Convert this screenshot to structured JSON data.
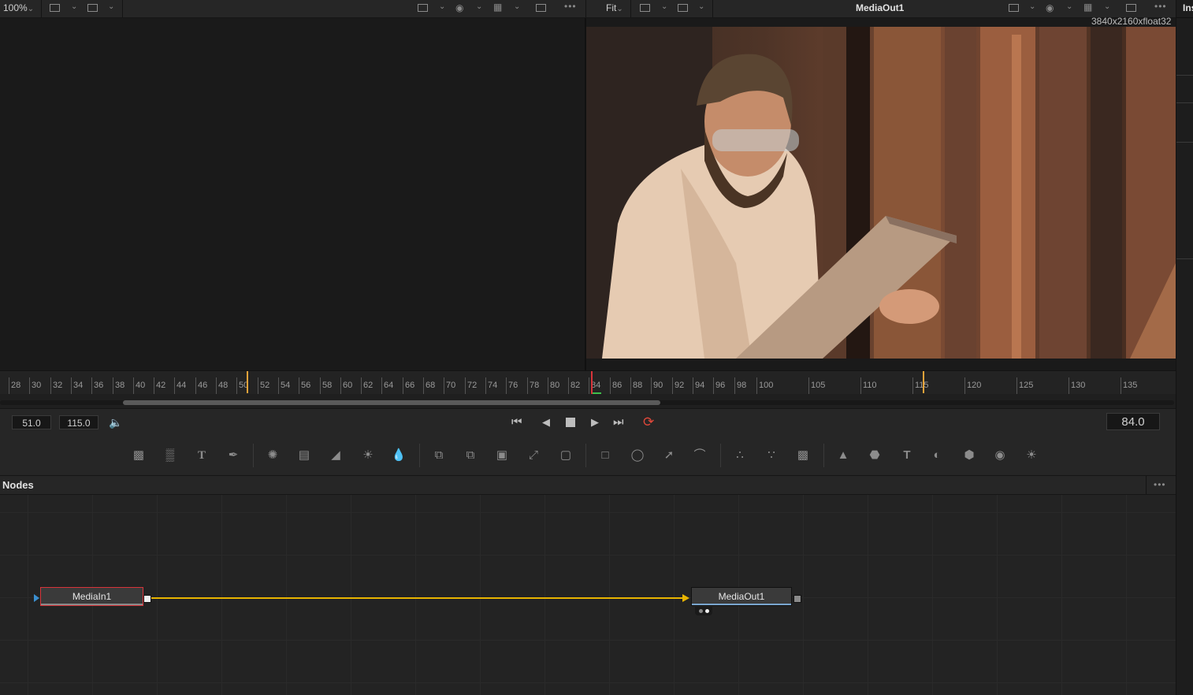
{
  "left_viewer": {
    "zoom": "100%",
    "zoom_chevron": "chevron-down-icon"
  },
  "right_viewer": {
    "zoom": "Fit",
    "title": "MediaOut1",
    "resolution": "3840x2160xfloat32"
  },
  "right_panel": {
    "label": "Ins"
  },
  "ruler": {
    "ticks_left": [
      "28",
      "30",
      "32",
      "34",
      "36",
      "38",
      "40",
      "42",
      "44",
      "46",
      "48",
      "50",
      "52",
      "54",
      "56",
      "58",
      "60",
      "62",
      "64",
      "66",
      "68",
      "70",
      "72",
      "74",
      "76",
      "78",
      "80",
      "82",
      "84",
      "86",
      "88",
      "90",
      "92",
      "94",
      "96",
      "98"
    ],
    "ticks_right": [
      "100",
      "105",
      "110",
      "115",
      "120",
      "125",
      "130",
      "135"
    ],
    "current_frame": "84"
  },
  "transport": {
    "render_start": "51.0",
    "render_end": "115.0",
    "current_time": "84.0"
  },
  "nodes_panel": {
    "title": "Nodes",
    "menu_icon": "more-icon",
    "nodes": [
      {
        "name": "MediaIn1",
        "selected": true
      },
      {
        "name": "MediaOut1",
        "selected": false
      }
    ]
  },
  "colors": {
    "accent_connection": "#e8b400",
    "playhead": "#e8a33a",
    "loop_active": "#e0483a",
    "selected_node_border": "#d8343a"
  }
}
